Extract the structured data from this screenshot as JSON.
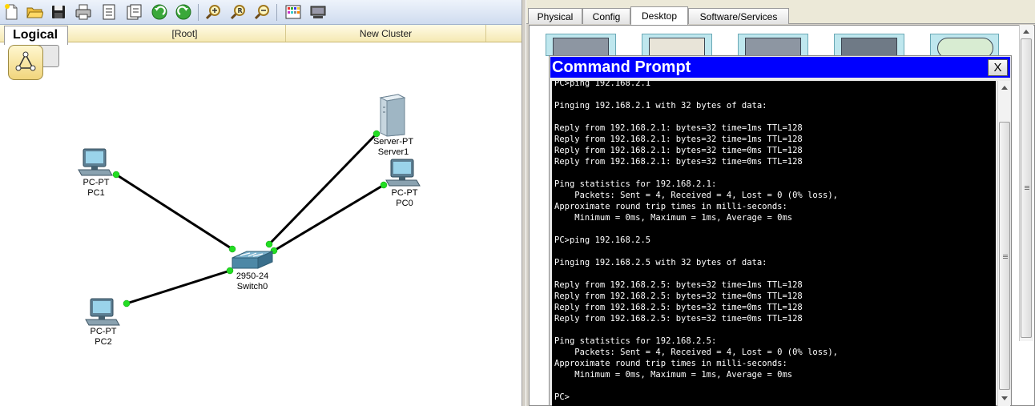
{
  "workspace": {
    "mode_tab": "Logical",
    "root_label": "[Root]",
    "cluster_label": "New Cluster"
  },
  "toolbar": {
    "icons": [
      "new-file-icon",
      "open-folder-icon",
      "save-icon",
      "print-icon",
      "activity-wizard-icon",
      "clipboard-icon",
      "undo-icon",
      "redo-icon",
      "zoom-in-icon",
      "zoom-reset-icon",
      "zoom-out-icon",
      "palette-icon",
      "custom-device-icon"
    ]
  },
  "devices": {
    "pc1": {
      "model": "PC-PT",
      "name": "PC1"
    },
    "pc2": {
      "model": "PC-PT",
      "name": "PC2"
    },
    "pc0": {
      "model": "PC-PT",
      "name": "PC0"
    },
    "server1": {
      "model": "Server-PT",
      "name": "Server1"
    },
    "switch0": {
      "model": "2950-24",
      "name": "Switch0"
    }
  },
  "link_status_color": "#22dd22",
  "device_window": {
    "tabs": [
      "Physical",
      "Config",
      "Desktop",
      "Software/Services"
    ],
    "active_tab": "Desktop",
    "command_prompt": {
      "title": "Command Prompt",
      "close_label": "X",
      "output": "PC>ping 192.168.2.1\n\nPinging 192.168.2.1 with 32 bytes of data:\n\nReply from 192.168.2.1: bytes=32 time=1ms TTL=128\nReply from 192.168.2.1: bytes=32 time=1ms TTL=128\nReply from 192.168.2.1: bytes=32 time=0ms TTL=128\nReply from 192.168.2.1: bytes=32 time=0ms TTL=128\n\nPing statistics for 192.168.2.1:\n    Packets: Sent = 4, Received = 4, Lost = 0 (0% loss),\nApproximate round trip times in milli-seconds:\n    Minimum = 0ms, Maximum = 1ms, Average = 0ms\n\nPC>ping 192.168.2.5\n\nPinging 192.168.2.5 with 32 bytes of data:\n\nReply from 192.168.2.5: bytes=32 time=1ms TTL=128\nReply from 192.168.2.5: bytes=32 time=0ms TTL=128\nReply from 192.168.2.5: bytes=32 time=0ms TTL=128\nReply from 192.168.2.5: bytes=32 time=0ms TTL=128\n\nPing statistics for 192.168.2.5:\n    Packets: Sent = 4, Received = 4, Lost = 0 (0% loss),\nApproximate round trip times in milli-seconds:\n    Minimum = 0ms, Maximum = 1ms, Average = 0ms\n\nPC>"
    }
  }
}
